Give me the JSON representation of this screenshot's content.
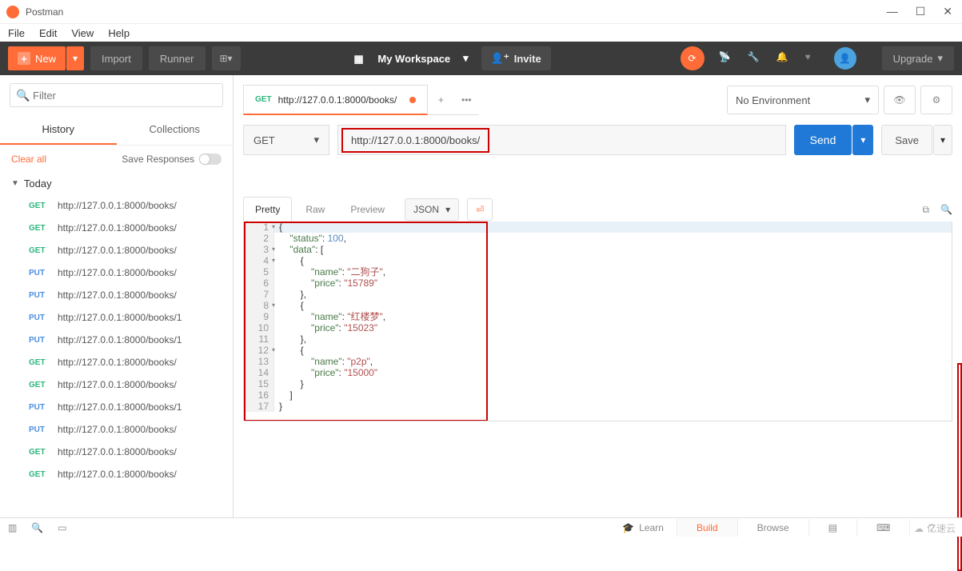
{
  "window": {
    "title": "Postman"
  },
  "menubar": {
    "file": "File",
    "edit": "Edit",
    "view": "View",
    "help": "Help"
  },
  "toolbar": {
    "new_label": "New",
    "import_label": "Import",
    "runner_label": "Runner",
    "workspace_label": "My Workspace",
    "invite_label": "Invite",
    "upgrade_label": "Upgrade"
  },
  "sidebar": {
    "filter_placeholder": "Filter",
    "tab_history": "History",
    "tab_collections": "Collections",
    "clear_all": "Clear all",
    "save_responses": "Save Responses",
    "group_today": "Today",
    "history": [
      {
        "method": "GET",
        "url": "http://127.0.0.1:8000/books/"
      },
      {
        "method": "GET",
        "url": "http://127.0.0.1:8000/books/"
      },
      {
        "method": "GET",
        "url": "http://127.0.0.1:8000/books/"
      },
      {
        "method": "PUT",
        "url": "http://127.0.0.1:8000/books/"
      },
      {
        "method": "PUT",
        "url": "http://127.0.0.1:8000/books/"
      },
      {
        "method": "PUT",
        "url": "http://127.0.0.1:8000/books/1"
      },
      {
        "method": "PUT",
        "url": "http://127.0.0.1:8000/books/1"
      },
      {
        "method": "GET",
        "url": "http://127.0.0.1:8000/books/"
      },
      {
        "method": "GET",
        "url": "http://127.0.0.1:8000/books/"
      },
      {
        "method": "PUT",
        "url": "http://127.0.0.1:8000/books/1"
      },
      {
        "method": "PUT",
        "url": "http://127.0.0.1:8000/books/"
      },
      {
        "method": "GET",
        "url": "http://127.0.0.1:8000/books/"
      },
      {
        "method": "GET",
        "url": "http://127.0.0.1:8000/books/"
      }
    ]
  },
  "request": {
    "tab_method": "GET",
    "tab_url": "http://127.0.0.1:8000/books/",
    "env_label": "No Environment",
    "method": "GET",
    "url": "http://127.0.0.1:8000/books/",
    "send_label": "Send",
    "save_label": "Save"
  },
  "response": {
    "tabs": {
      "pretty": "Pretty",
      "raw": "Raw",
      "preview": "Preview"
    },
    "format": "JSON",
    "body_lines": [
      {
        "n": 1,
        "fold": true,
        "text": "{"
      },
      {
        "n": 2,
        "text": "    \"status\": 100,",
        "tokens": [
          [
            "    "
          ],
          [
            "k",
            "\"status\""
          ],
          [
            ": "
          ],
          [
            "n",
            "100"
          ],
          [
            ","
          ]
        ]
      },
      {
        "n": 3,
        "fold": true,
        "text": "    \"data\": [",
        "tokens": [
          [
            "    "
          ],
          [
            "k",
            "\"data\""
          ],
          [
            ": ["
          ]
        ]
      },
      {
        "n": 4,
        "fold": true,
        "text": "        {",
        "tokens": [
          [
            "        {"
          ]
        ]
      },
      {
        "n": 5,
        "text": "            \"name\": \"二狗子\",",
        "tokens": [
          [
            "            "
          ],
          [
            "k",
            "\"name\""
          ],
          [
            ": "
          ],
          [
            "s",
            "\"二狗子\""
          ],
          [
            ","
          ]
        ]
      },
      {
        "n": 6,
        "text": "            \"price\": \"15789\"",
        "tokens": [
          [
            "            "
          ],
          [
            "k",
            "\"price\""
          ],
          [
            ": "
          ],
          [
            "s",
            "\"15789\""
          ]
        ]
      },
      {
        "n": 7,
        "text": "        },",
        "tokens": [
          [
            "        },"
          ]
        ]
      },
      {
        "n": 8,
        "fold": true,
        "text": "        {",
        "tokens": [
          [
            "        {"
          ]
        ]
      },
      {
        "n": 9,
        "text": "            \"name\": \"红楼梦\",",
        "tokens": [
          [
            "            "
          ],
          [
            "k",
            "\"name\""
          ],
          [
            ": "
          ],
          [
            "s",
            "\"红楼梦\""
          ],
          [
            ","
          ]
        ]
      },
      {
        "n": 10,
        "text": "            \"price\": \"15023\"",
        "tokens": [
          [
            "            "
          ],
          [
            "k",
            "\"price\""
          ],
          [
            ": "
          ],
          [
            "s",
            "\"15023\""
          ]
        ]
      },
      {
        "n": 11,
        "text": "        },",
        "tokens": [
          [
            "        },"
          ]
        ]
      },
      {
        "n": 12,
        "fold": true,
        "text": "        {",
        "tokens": [
          [
            "        {"
          ]
        ]
      },
      {
        "n": 13,
        "text": "            \"name\": \"p2p\",",
        "tokens": [
          [
            "            "
          ],
          [
            "k",
            "\"name\""
          ],
          [
            ": "
          ],
          [
            "s",
            "\"p2p\""
          ],
          [
            ","
          ]
        ]
      },
      {
        "n": 14,
        "text": "            \"price\": \"15000\"",
        "tokens": [
          [
            "            "
          ],
          [
            "k",
            "\"price\""
          ],
          [
            ": "
          ],
          [
            "s",
            "\"15000\""
          ]
        ]
      },
      {
        "n": 15,
        "text": "        }",
        "tokens": [
          [
            "        }"
          ]
        ]
      },
      {
        "n": 16,
        "text": "    ]",
        "tokens": [
          [
            "    ]"
          ]
        ]
      },
      {
        "n": 17,
        "text": "}",
        "tokens": [
          [
            "}"
          ]
        ]
      }
    ]
  },
  "statusbar": {
    "learn": "Learn",
    "build": "Build",
    "browse": "Browse"
  },
  "watermark": "亿速云"
}
